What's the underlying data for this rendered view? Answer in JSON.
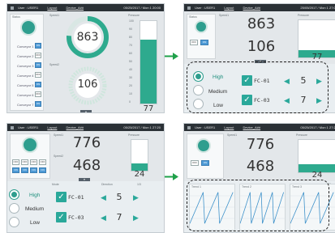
{
  "titlebar": {
    "user": "User : USER1",
    "user_short": "User : USER1",
    "link1": "Layout",
    "link2": "Device_A##",
    "time_a": "05/25/2017 / Mon 1 20:00",
    "time_b": "25/05/2017 / Mon 1 27:00",
    "time_c": "05/25/2017 / Mon 1 27:20",
    "time_d": "05/25/2017 / Mon 1 27:20"
  },
  "panel1": {
    "label_status": "Status",
    "label_speed": "Speed1",
    "label_speed2": "Speed2",
    "label_pressure": "Pressure",
    "big_value": "863",
    "ring_value": "106",
    "gauge_value": "77",
    "rows": [
      "Conveyor 1",
      "Conveyor 2",
      "Conveyor 3",
      "Conveyor 4",
      "Conveyor 5",
      "Conveyor 6",
      "Conveyor 7"
    ],
    "btn_off": "OFF",
    "btn_on": "ON",
    "scale": [
      "100",
      "90",
      "80",
      "70",
      "60",
      "50",
      "40",
      "30",
      "20",
      "10",
      "0"
    ]
  },
  "panel2": {
    "label_status": "Status",
    "label_speed": "Speed1",
    "label_pressure": "Pressure",
    "big_value": "863",
    "value2": "106",
    "gauge_value": "77"
  },
  "panel3": {
    "label_speed": "Speed1",
    "label_speed2": "Speed2",
    "label_pressure": "Pressure",
    "big_value": "776",
    "value2": "468",
    "gauge_value": "24",
    "label_mode": "Mode",
    "label_direction": "Direction",
    "page": "1/3"
  },
  "panel4": {
    "label_speed": "Speed1",
    "label_pressure": "Pressure",
    "big_value": "776",
    "value2": "468",
    "gauge_value": "24",
    "page": "2/3",
    "trend_labels": [
      "Trend 1",
      "Trend 2",
      "Trend 3"
    ]
  },
  "control": {
    "high": "High",
    "medium": "Medium",
    "low": "Low",
    "fc1": "FC-01",
    "fc3": "FC-03",
    "fc1_value": "5",
    "fc3_value": "7"
  },
  "colors": {
    "accent": "#2e9e8e",
    "gauge": "#2eaa8e",
    "arrow": "#1fa14a",
    "titlebar": "#2b3136"
  }
}
